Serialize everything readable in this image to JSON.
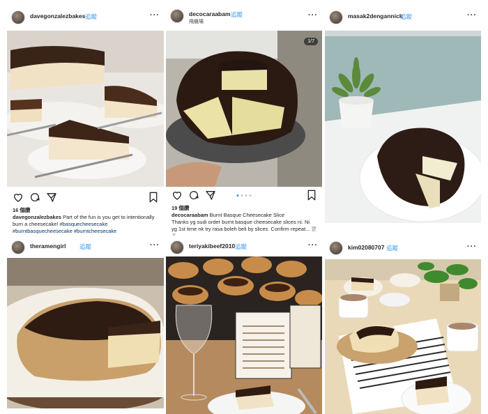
{
  "posts": [
    {
      "username": "davegonzalezbakes",
      "follow": "追蹤",
      "likes": "16 個讚",
      "caption_user": "davegonzalezbakes",
      "caption_text": "Part of the fun is you get to intentionally burn a cheesecake!",
      "caption_tags": "#basquecheesecake #burntbasquecheesecake #burntcheesecake"
    },
    {
      "username": "decocaraabam",
      "follow": "追蹤",
      "location": "飛機場",
      "counter": "1/7",
      "likes": "19 個讚",
      "caption_user": "decocaraabam",
      "caption_text": "Burnt Basque Cheesecake Slice",
      "caption_line2": "Thanks yg sudi order burnt basque cheesecake slices ni. Ni yg 1st time nk try rasa boleh beli by slices. Confirm repeat...",
      "caption_more": "更多"
    },
    {
      "username": "masak2dengannick",
      "follow": "追蹤"
    },
    {
      "username": "theramengirl",
      "follow": "追蹤"
    },
    {
      "username": "teriyakibeef2010",
      "follow": "追蹤"
    },
    {
      "username": "kim02080707",
      "follow": "追蹤"
    }
  ],
  "icons": {
    "more": "more-options-icon",
    "like": "heart-icon",
    "comment": "comment-icon",
    "share": "share-icon",
    "save": "bookmark-icon"
  }
}
